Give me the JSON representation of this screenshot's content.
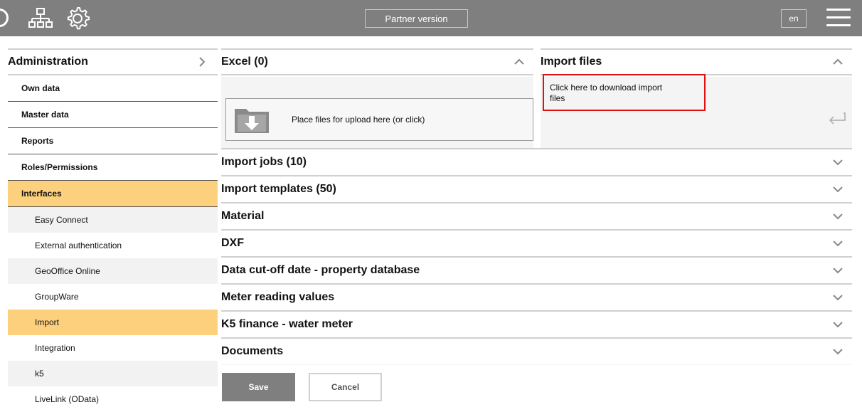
{
  "header": {
    "partner_label": "Partner version",
    "language": "en"
  },
  "sidebar": {
    "title": "Administration",
    "items": [
      {
        "label": "Own data"
      },
      {
        "label": "Master data"
      },
      {
        "label": "Reports"
      },
      {
        "label": "Roles/Permissions"
      },
      {
        "label": "Interfaces"
      }
    ],
    "subitems": [
      {
        "label": "Easy Connect"
      },
      {
        "label": "External authentication"
      },
      {
        "label": "GeoOffice Online"
      },
      {
        "label": "GroupWare"
      },
      {
        "label": "Import"
      },
      {
        "label": "Integration"
      },
      {
        "label": "k5"
      },
      {
        "label": "LiveLink (OData)"
      }
    ]
  },
  "excel": {
    "title": "Excel (0)",
    "upload_text": "Place files for upload here (or click)"
  },
  "import_files": {
    "title": "Import files",
    "download_text": "Click here to download import files"
  },
  "sections": [
    {
      "label": "Import jobs (10)"
    },
    {
      "label": "Import templates (50)"
    },
    {
      "label": "Material"
    },
    {
      "label": "DXF"
    },
    {
      "label": "Data cut-off date - property database"
    },
    {
      "label": "Meter reading values"
    },
    {
      "label": "K5 finance - water meter"
    },
    {
      "label": "Documents"
    }
  ],
  "actions": {
    "save": "Save",
    "cancel": "Cancel"
  },
  "colors": {
    "topbar": "#7f7f7f",
    "active": "#fdd07e",
    "highlight_border": "#e01010"
  }
}
